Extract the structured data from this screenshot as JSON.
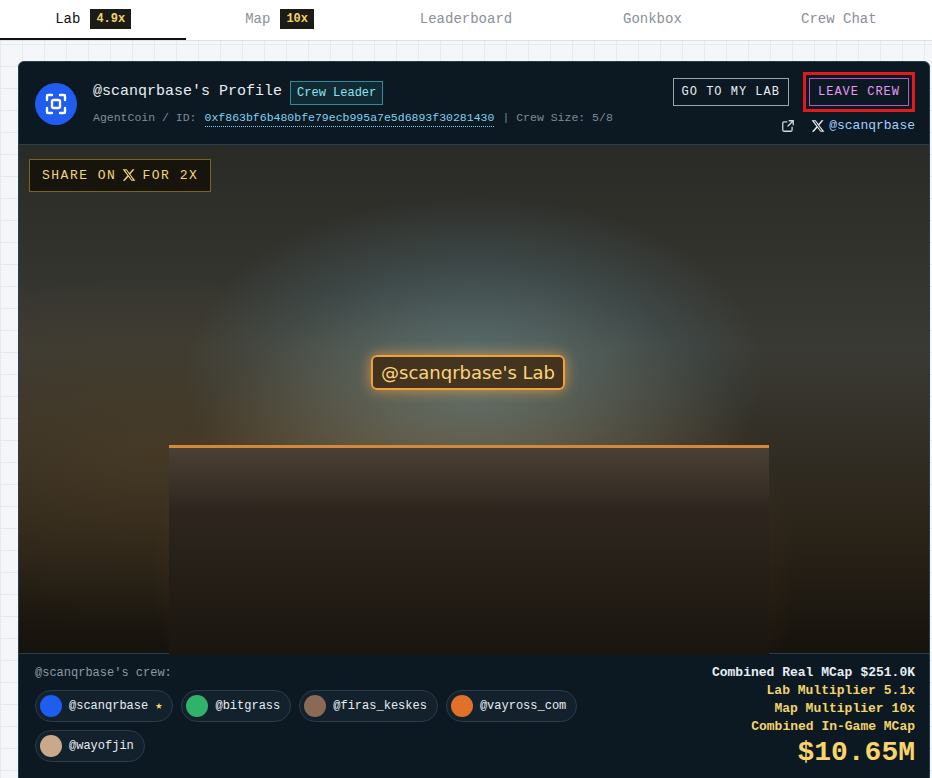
{
  "tabs": [
    {
      "label": "Lab",
      "badge": "4.9x",
      "selected": true
    },
    {
      "label": "Map",
      "badge": "10x",
      "selected": false
    },
    {
      "label": "Leaderboard",
      "selected": false
    },
    {
      "label": "Gonkbox",
      "selected": false
    },
    {
      "label": "Crew Chat",
      "selected": false
    }
  ],
  "profile": {
    "title": "@scanqrbase's Profile",
    "role": "Crew Leader",
    "id_prefix": "AgentCoin / ID:",
    "id": "0xf863bf6b480bfe79ecb995a7e5d6893f30281430",
    "crew_size": "| Crew Size: 5/8",
    "buttons": [
      {
        "label": "GO TO MY LAB",
        "highlighted": false
      },
      {
        "label": "LEAVE CREW",
        "highlighted": true
      }
    ],
    "handle": "@scanqrbase"
  },
  "photo": {
    "share_before": "SHARE ON",
    "share_after": "FOR 2X",
    "lab_label": "@scanqrbase's Lab"
  },
  "crew": {
    "title": "@scanqrbase's crew:",
    "leader_mark": "★",
    "members": [
      {
        "handle": "@scanqrbase",
        "leader": true,
        "color": "#1f5cf0"
      },
      {
        "handle": "@bitgrass",
        "leader": false,
        "color": "#2fb36a"
      },
      {
        "handle": "@firas_keskes",
        "leader": false,
        "color": "#8a6a55"
      },
      {
        "handle": "@vayross_com",
        "leader": false,
        "color": "#e0702a"
      },
      {
        "handle": "@wayofjin",
        "leader": false,
        "color": "#c9a98a"
      }
    ]
  },
  "stats": [
    {
      "label": "Combined Real MCap",
      "value": "$251.0K"
    },
    {
      "label": "Lab Multiplier",
      "value": "5.1x"
    },
    {
      "label": "Map Multiplier",
      "value": "10x"
    }
  ],
  "total": {
    "label": "Combined In-Game MCap",
    "value": "$10.65M"
  }
}
